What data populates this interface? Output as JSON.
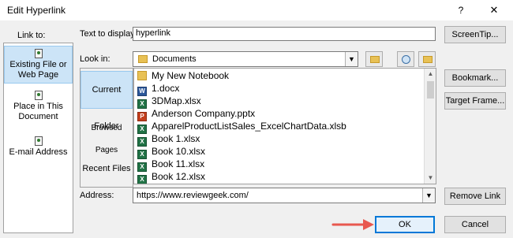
{
  "dialog": {
    "title": "Edit Hyperlink",
    "help_glyph": "?",
    "close_glyph": "✕"
  },
  "link_to": {
    "label": "Link to:",
    "items": [
      {
        "label": "Existing File or Web Page",
        "icon": "file-web-icon",
        "selected": true
      },
      {
        "label": "Place in This Document",
        "icon": "document-place-icon",
        "selected": false
      },
      {
        "label": "E-mail Address",
        "icon": "email-icon",
        "selected": false
      }
    ]
  },
  "text_to_display": {
    "label": "Text to display:",
    "value": "hyperlink"
  },
  "look_in": {
    "label": "Look in:",
    "value": "Documents"
  },
  "folder_tabs": [
    {
      "label": "Current Folder",
      "selected": true
    },
    {
      "label": "Browsed Pages",
      "selected": false
    },
    {
      "label": "Recent Files",
      "selected": false
    }
  ],
  "files": [
    {
      "name": "My New Notebook",
      "type": "folder"
    },
    {
      "name": "1.docx",
      "type": "word"
    },
    {
      "name": "3DMap.xlsx",
      "type": "excel"
    },
    {
      "name": "Anderson Company.pptx",
      "type": "powerpoint"
    },
    {
      "name": "ApparelProductListSales_ExcelChartData.xlsb",
      "type": "excel"
    },
    {
      "name": "Book 1.xlsx",
      "type": "excel"
    },
    {
      "name": "Book 10.xlsx",
      "type": "excel"
    },
    {
      "name": "Book 11.xlsx",
      "type": "excel"
    },
    {
      "name": "Book 12.xlsx",
      "type": "excel"
    }
  ],
  "address": {
    "label": "Address:",
    "value": "https://www.reviewgeek.com/"
  },
  "buttons": {
    "screentip": "ScreenTip...",
    "bookmark": "Bookmark...",
    "target_frame": "Target Frame...",
    "remove_link": "Remove Link",
    "ok": "OK",
    "cancel": "Cancel"
  },
  "colors": {
    "selection": "#cce4f7",
    "ok_border": "#0078d7",
    "annotation_arrow": "#e8584f"
  }
}
